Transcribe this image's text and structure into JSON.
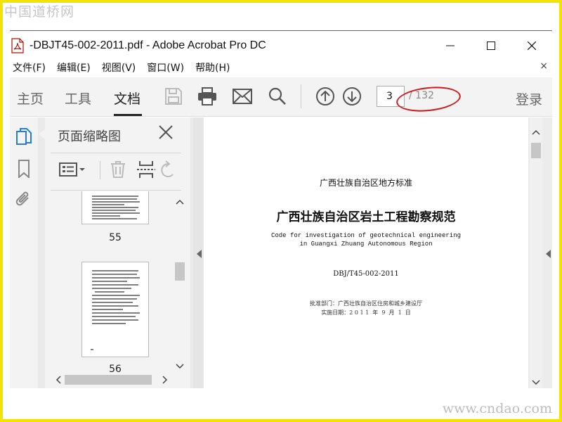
{
  "watermarks": {
    "top": "中国道桥网",
    "bottom": "www.cndao.com"
  },
  "window": {
    "title": "-DBJT45-002-2011.pdf - Adobe Acrobat Pro DC"
  },
  "menu": {
    "items": [
      "文件(F)",
      "编辑(E)",
      "视图(V)",
      "窗口(W)",
      "帮助(H)"
    ],
    "close": "×"
  },
  "toolbar": {
    "tabs": [
      "主页",
      "工具",
      "文档"
    ],
    "active_tab": "文档",
    "page_current": "3",
    "page_total": "/ 132",
    "login": "登录",
    "icons": [
      "save-icon",
      "print-icon",
      "email-icon",
      "search-icon",
      "page-up-icon",
      "page-down-icon"
    ]
  },
  "panel": {
    "title": "页面缩略图",
    "thumbnails": [
      {
        "page": "55"
      },
      {
        "page": "56"
      }
    ]
  },
  "document": {
    "header": "广西壮族自治区地方标准",
    "title": "广西壮族自治区岩土工程勘察规范",
    "subtitle_line1": "Code for investigation of geotechnical engineering",
    "subtitle_line2": "in Guangxi Zhuang Autonomous Region",
    "code": "DBJ/T45-002-2011",
    "approver": "批准部门：广西壮族自治区住房和城乡建设厅",
    "date": "实施日期：2 0 1 1  年  9  月  1  日"
  },
  "colors": {
    "annotation": "#cc1b1b",
    "frame": "#f2e300",
    "title_line": "#2e7f7a"
  }
}
